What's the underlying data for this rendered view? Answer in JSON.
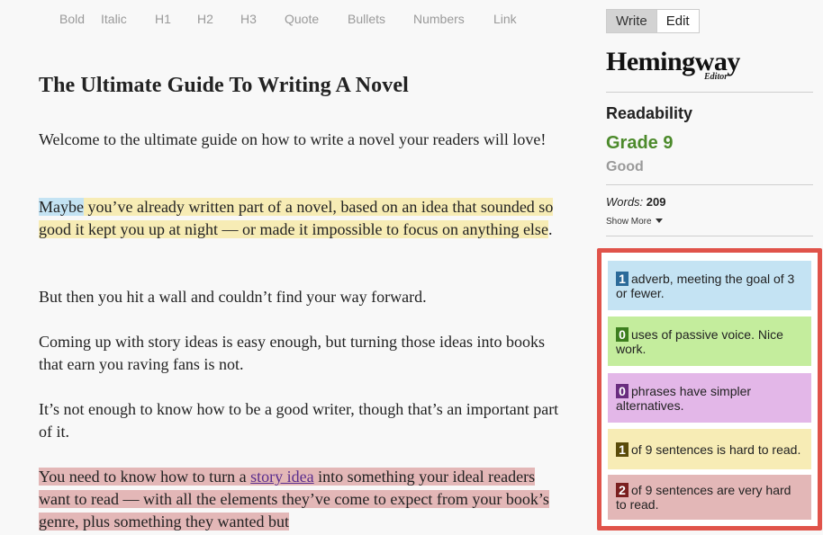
{
  "toolbar": {
    "items": [
      "Bold",
      "Italic",
      "H1",
      "H2",
      "H3",
      "Quote",
      "Bullets",
      "Numbers",
      "Link"
    ]
  },
  "document": {
    "title": "The Ultimate Guide To Writing A Novel",
    "p1": "Welcome to the ultimate guide on how to write a novel your readers will love!",
    "p2_adverb": "Maybe",
    "p2_hard": " you’ve already written part of a novel, based on an idea that sounded so good it kept you up at night — or made it impossible to focus on anything else",
    "p2_end": ".",
    "p3": "But then you hit a wall and couldn’t find your way forward.",
    "p4": "Coming up with story ideas is easy enough, but turning those ideas into books that earn you raving fans is not.",
    "p5": "It’s not enough to know how to be a good writer, though that’s an important part of it.",
    "p6_start": "You need to know how to turn a ",
    "p6_link": "story idea",
    "p6_rest": " into something your ideal readers want to read — with all the elements they’ve come to expect from your book’s genre, plus something they wanted but"
  },
  "mode": {
    "write": "Write",
    "edit": "Edit"
  },
  "logo": {
    "name": "Hemingway",
    "sub": "Editor"
  },
  "readability": {
    "label": "Readability",
    "grade": "Grade 9",
    "desc": "Good"
  },
  "words": {
    "label": "Words:",
    "count": "209",
    "show_more": "Show More"
  },
  "stats": {
    "adverb": {
      "count": "1",
      "text": "adverb, meeting the goal of 3 or fewer."
    },
    "passive": {
      "count": "0",
      "text": "uses of passive voice. Nice work."
    },
    "simpler": {
      "count": "0",
      "text": "phrases have simpler alternatives."
    },
    "hard": {
      "count": "1",
      "text": "of 9 sentences is hard to read."
    },
    "veryhard": {
      "count": "2",
      "text": "of 9 sentences are very hard to read."
    }
  },
  "colors": {
    "adverb": "#c4e3f3",
    "passive": "#c4ed9d",
    "simpler": "#e3b7e8",
    "hard": "#f7ecb5",
    "veryhard": "#e3b7b7",
    "grade": "#4c8a2b",
    "highlight_frame": "#e0534a"
  }
}
